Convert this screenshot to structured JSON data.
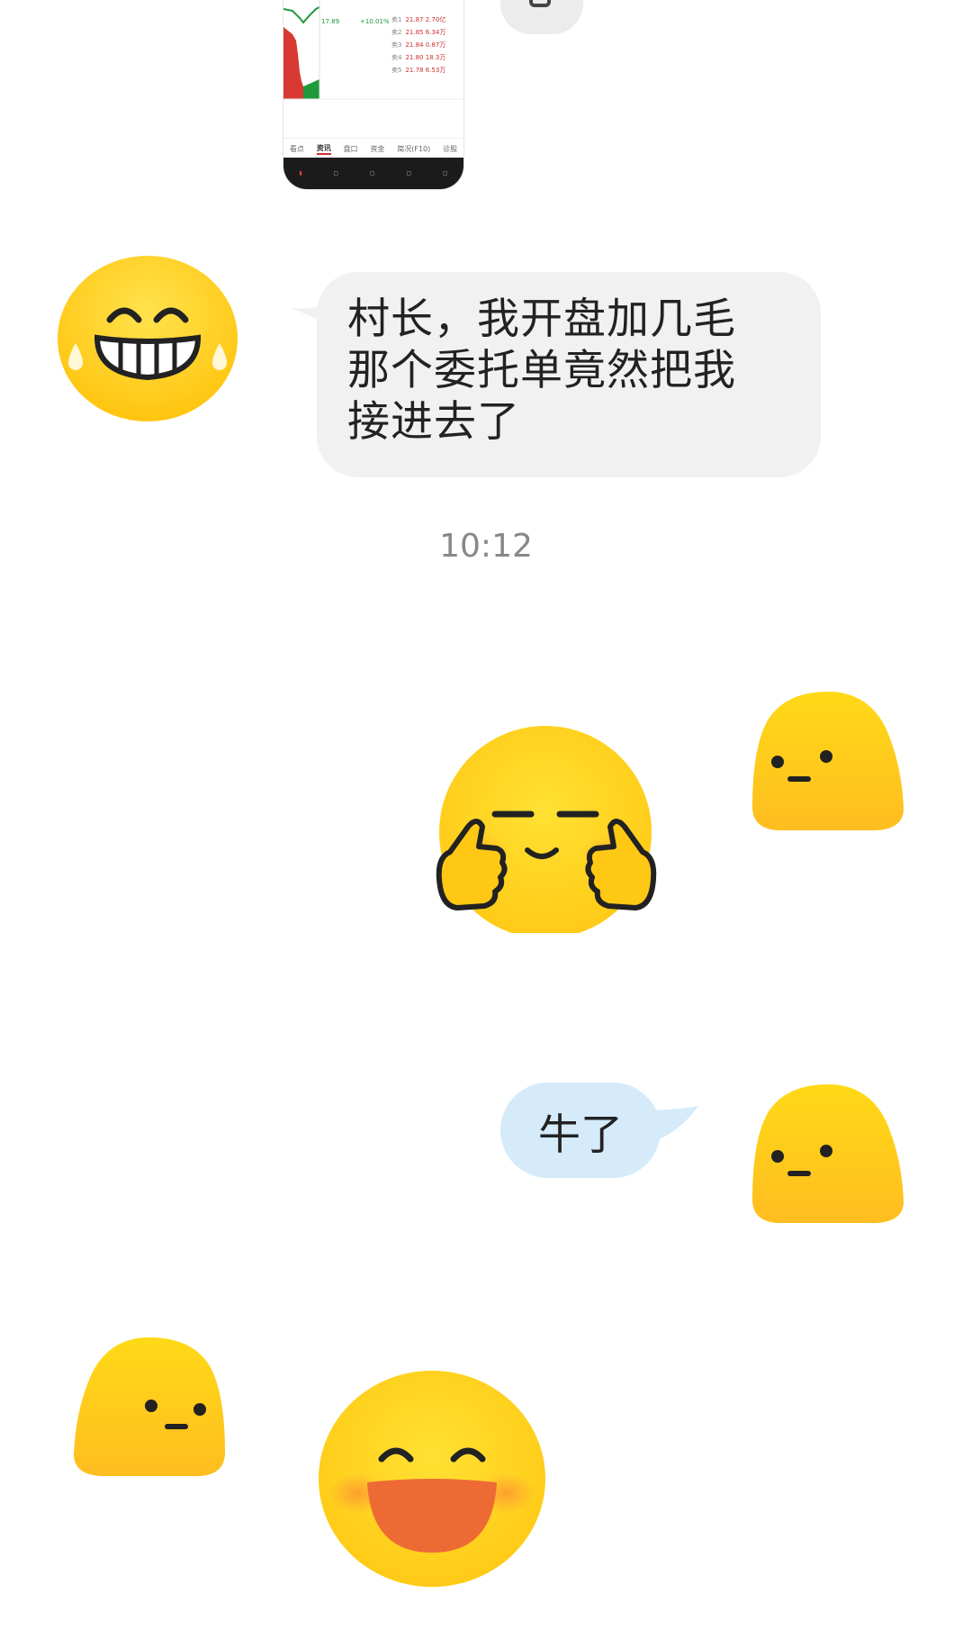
{
  "thumbnail": {
    "quote_rows": [
      {
        "label": "卖1",
        "value": "21.87 2.70亿"
      },
      {
        "label": "卖2",
        "value": "21.85 6.34万"
      },
      {
        "label": "卖3",
        "value": "21.84 0.87万"
      },
      {
        "label": "卖4",
        "value": "21.80 18.3万"
      },
      {
        "label": "卖5",
        "value": "21.78 6.53万"
      }
    ],
    "price_top": "17.89",
    "change_pct": "+10.01%",
    "tabs": [
      "看点",
      "资讯",
      "盘口",
      "资金",
      "简况(F10)",
      "诊股"
    ],
    "active_tab": "资讯"
  },
  "messages": [
    {
      "id": "m1",
      "direction": "incoming",
      "text_lines": [
        "村长，我开盘加几毛",
        "那个委托单竟然把我",
        "接进去了"
      ]
    },
    {
      "id": "m2",
      "direction": "outgoing",
      "text": "牛了"
    }
  ],
  "timestamp": "10:12",
  "colors": {
    "incoming_bubble": "#f1f1f1",
    "outgoing_bubble": "#d5ebfa",
    "emoji_yellow": "#ffd21f"
  }
}
